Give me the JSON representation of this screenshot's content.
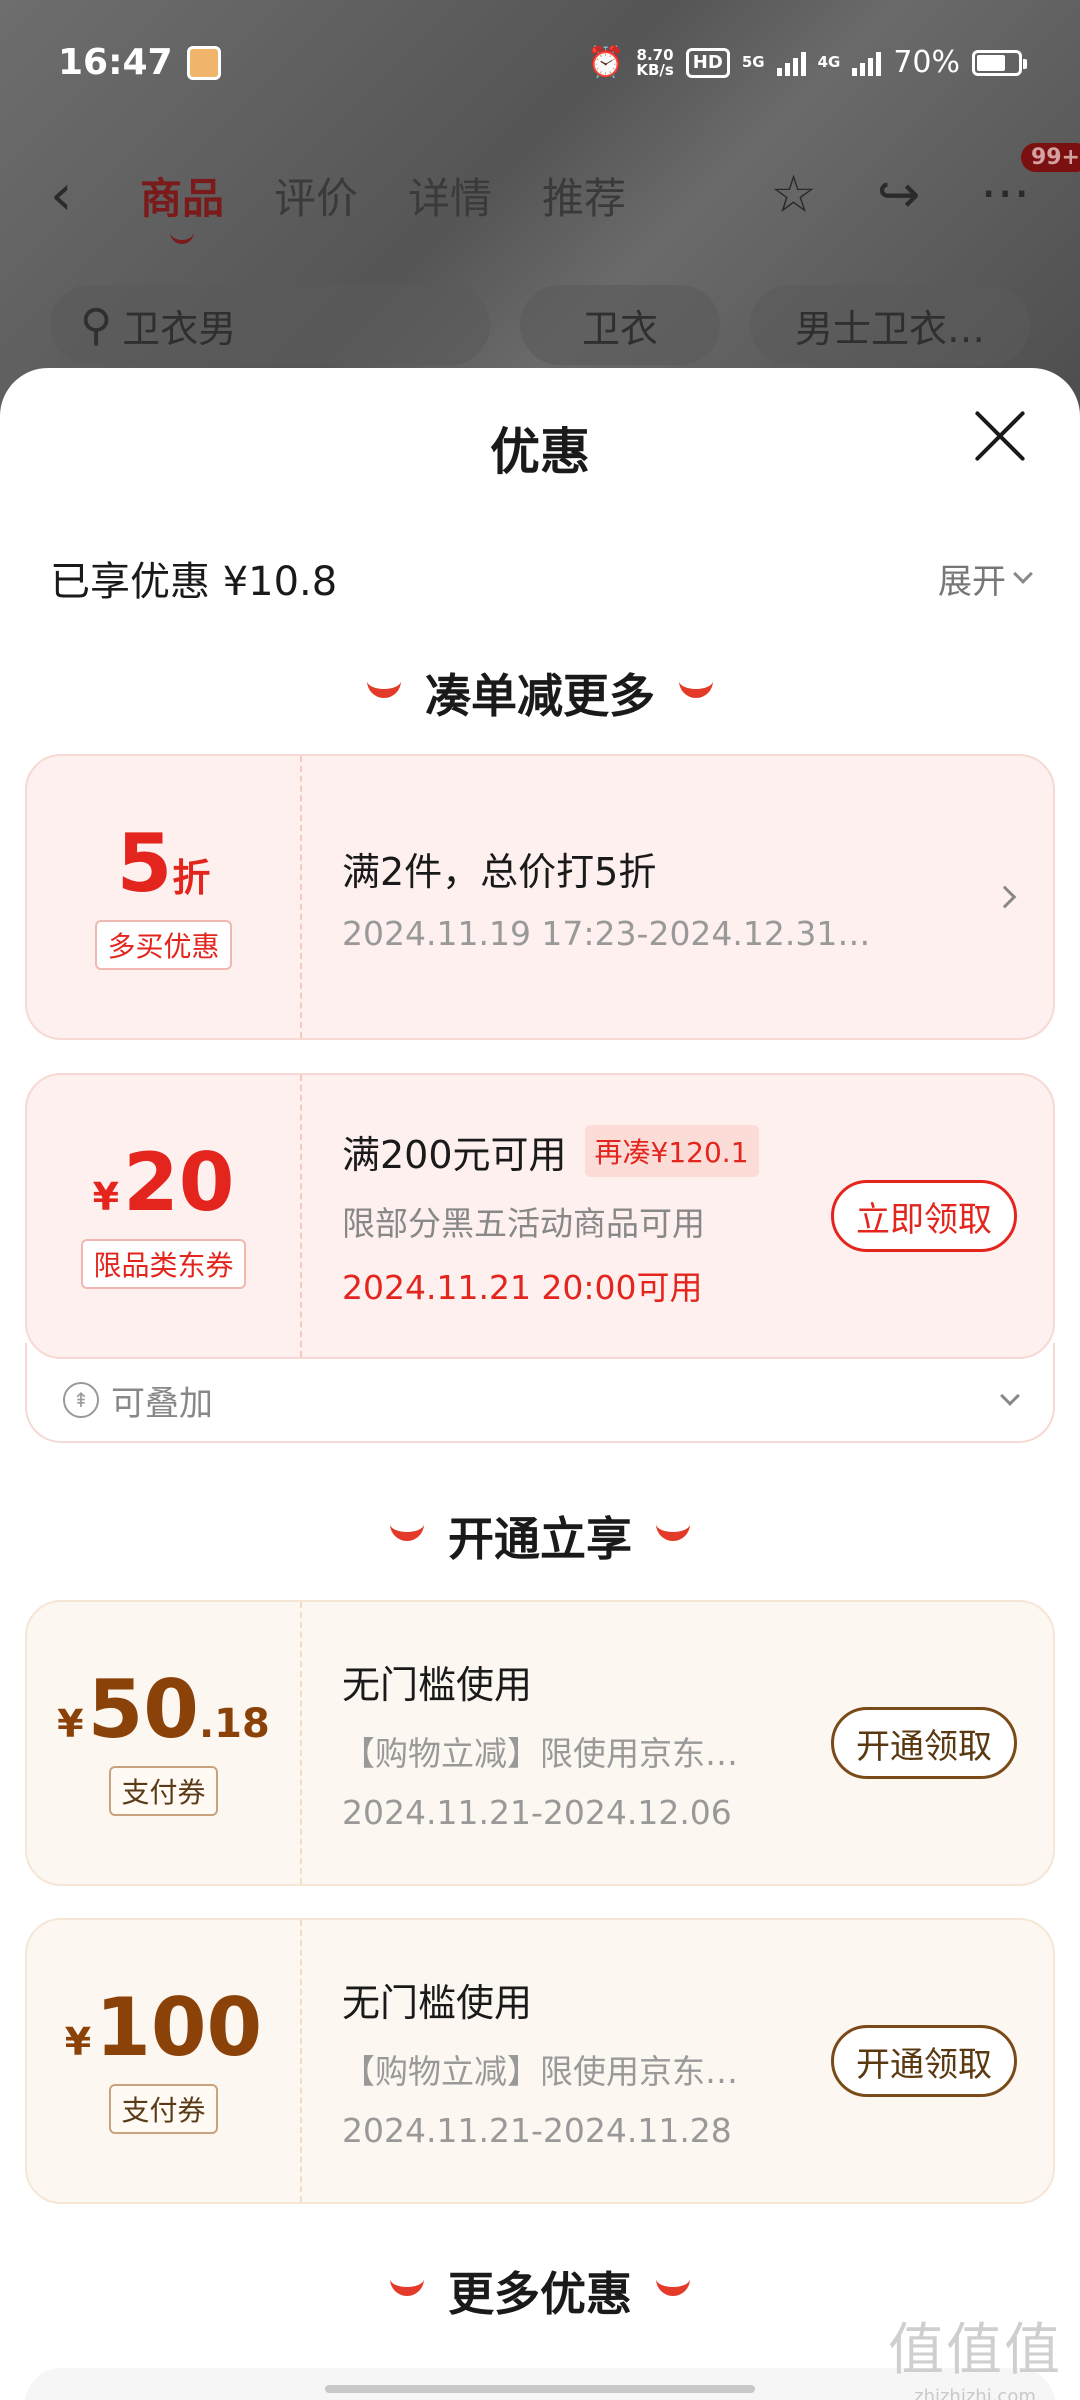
{
  "status_bar": {
    "time": "16:47",
    "net_speed_top": "8.70",
    "net_speed_bottom": "KB/s",
    "hd_label": "HD",
    "sim1": "1",
    "sim2": "2",
    "net_5g": "5G",
    "net_4g": "4G",
    "battery": "70%"
  },
  "nav": {
    "back_icon": "chevron-left-icon",
    "tabs": [
      "商品",
      "评价",
      "详情",
      "推荐"
    ],
    "badge": "99+"
  },
  "search": {
    "query": "卫衣男",
    "chips": [
      "卫衣",
      "男士卫衣…"
    ]
  },
  "sheet": {
    "title": "优惠",
    "enjoyed": "已享优惠 ¥10.8",
    "expand": "展开"
  },
  "sections": {
    "combo": "凑单减更多",
    "membership": "开通立享",
    "more": "更多优惠"
  },
  "cards": {
    "discount": {
      "value": "5",
      "unit": "折",
      "tag": "多买优惠",
      "title": "满2件，总价打5折",
      "date": "2024.11.19 17:23-2024.12.31…"
    },
    "coupon20": {
      "yen": "¥",
      "value": "20",
      "tag": "限品类东券",
      "title": "满200元可用",
      "need": "再凑¥120.1",
      "sub": "限部分黑五活动商品可用",
      "date": "2024.11.21 20:00可用",
      "button": "立即领取",
      "stack": "可叠加"
    },
    "pay50": {
      "yen": "¥",
      "value": "50",
      "decimal": ".18",
      "tag": "支付券",
      "title": "无门槛使用",
      "sub": "【购物立减】限使用京东…",
      "date": "2024.11.21-2024.12.06",
      "button": "开通领取"
    },
    "pay100": {
      "yen": "¥",
      "value": "100",
      "tag": "支付券",
      "title": "无门槛使用",
      "sub": "【购物立减】限使用京东…",
      "date": "2024.11.21-2024.11.28",
      "button": "开通领取"
    }
  },
  "watermark": {
    "logo": "值值值",
    "url": "zhizhizhi.com"
  },
  "colors": {
    "accent_red": "#e3251e",
    "gold_brown": "#8a4209"
  }
}
